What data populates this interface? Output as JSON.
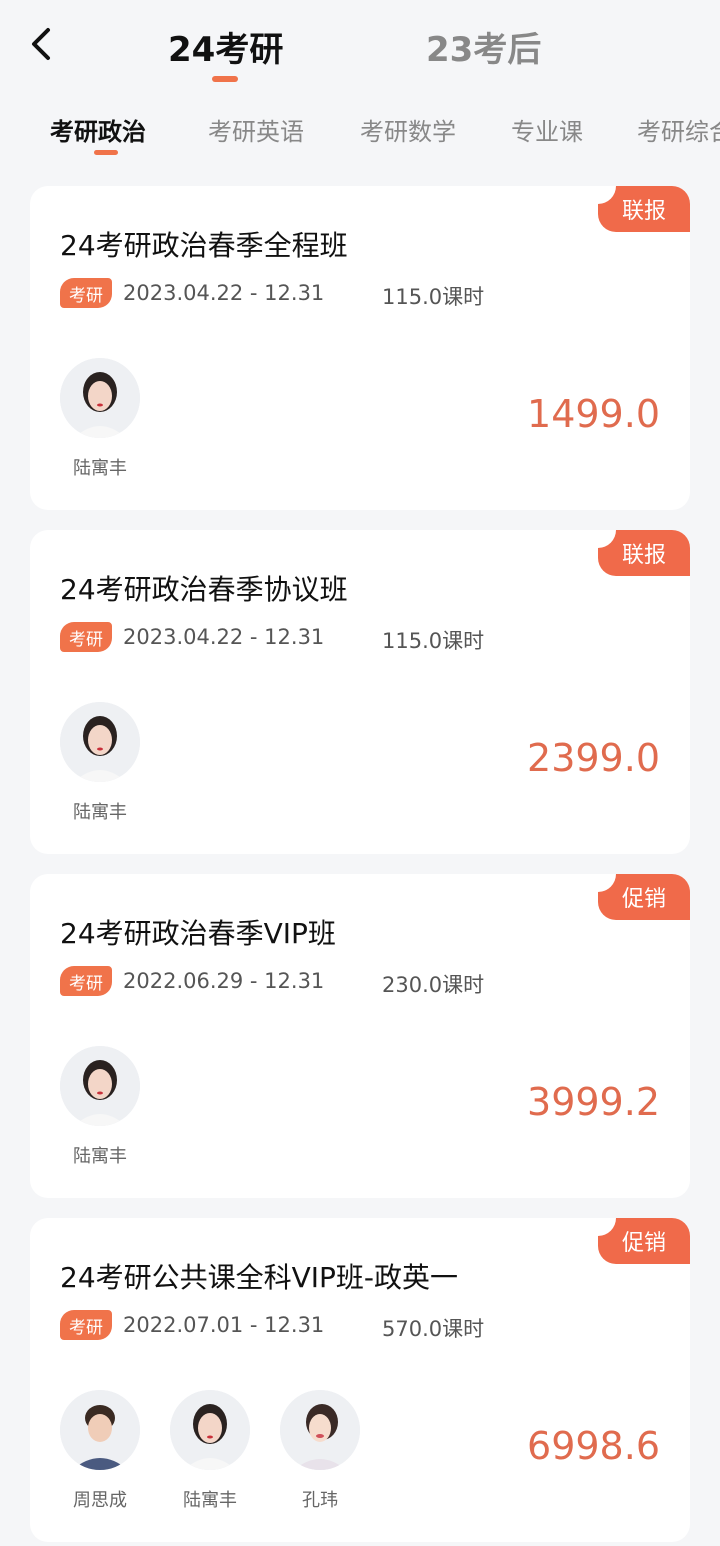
{
  "header": {
    "tabs": [
      {
        "label": "24考研",
        "active": true
      },
      {
        "label": "23考后",
        "active": false
      }
    ]
  },
  "subtabs": [
    "考研政治",
    "考研英语",
    "考研数学",
    "专业课",
    "考研综合"
  ],
  "colors": {
    "accent": "#f0734a",
    "price": "#e06b4e",
    "badge": "#f06a4a"
  },
  "courses": [
    {
      "title": "24考研政治春季全程班",
      "badge": "联报",
      "tag": "考研",
      "dates": "2023.04.22 - 12.31",
      "hours": "115.0课时",
      "price": "1499.0",
      "teachers": [
        "陆寓丰"
      ]
    },
    {
      "title": "24考研政治春季协议班",
      "badge": "联报",
      "tag": "考研",
      "dates": "2023.04.22 - 12.31",
      "hours": "115.0课时",
      "price": "2399.0",
      "teachers": [
        "陆寓丰"
      ]
    },
    {
      "title": "24考研政治春季VIP班",
      "badge": "促销",
      "tag": "考研",
      "dates": "2022.06.29 - 12.31",
      "hours": "230.0课时",
      "price": "3999.2",
      "teachers": [
        "陆寓丰"
      ]
    },
    {
      "title": "24考研公共课全科VIP班-政英一",
      "badge": "促销",
      "tag": "考研",
      "dates": "2022.07.01 - 12.31",
      "hours": "570.0课时",
      "price": "6998.6",
      "teachers": [
        "周思成",
        "陆寓丰",
        "孔玮"
      ]
    }
  ]
}
